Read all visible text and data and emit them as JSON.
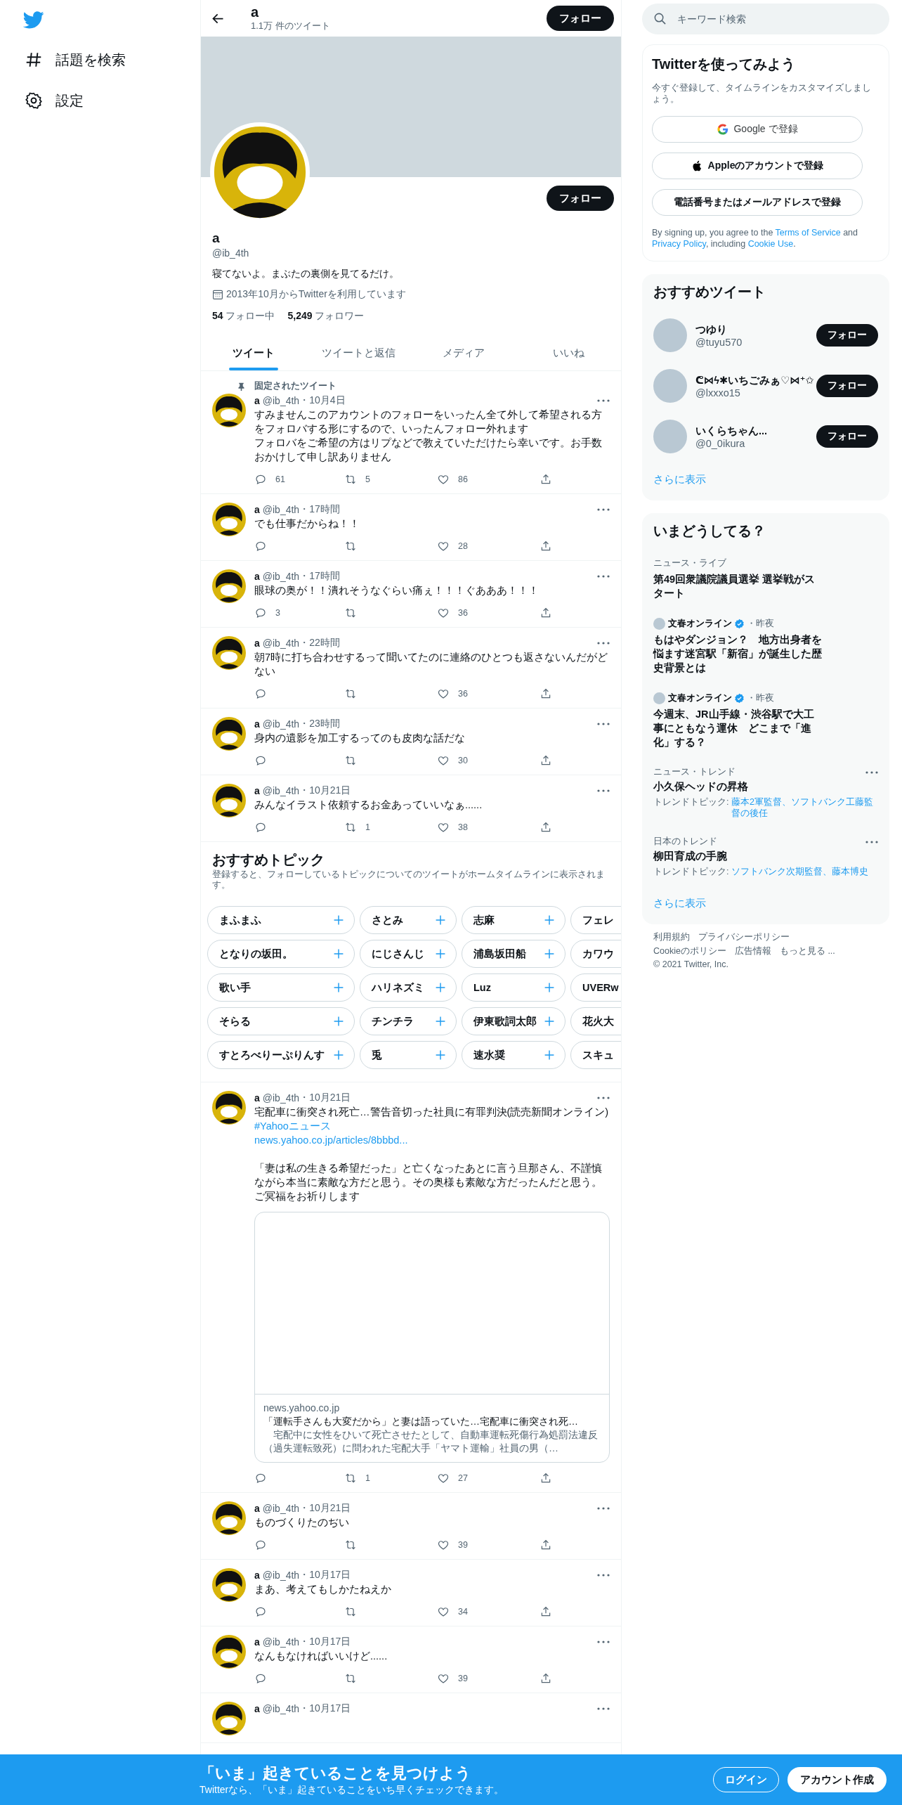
{
  "sidebar": {
    "items": [
      {
        "kind": "explore",
        "label": "話題を検索"
      },
      {
        "kind": "settings",
        "label": "設定"
      }
    ]
  },
  "header": {
    "title": "a",
    "subtitle": "1.1万 件のツイート",
    "follow": "フォロー"
  },
  "profile": {
    "follow": "フォロー",
    "name": "a",
    "handle": "@ib_4th",
    "bio": "寝てないよ。まぶたの裏側を見てるだけ。",
    "joined": "2013年10月からTwitterを利用しています",
    "following_count": "54",
    "following_label": "フォロー中",
    "followers_count": "5,249",
    "followers_label": "フォロワー"
  },
  "tabs": [
    {
      "label": "ツイート",
      "selected": true
    },
    {
      "label": "ツイートと返信",
      "selected": false
    },
    {
      "label": "メディア",
      "selected": false
    },
    {
      "label": "いいね",
      "selected": false
    }
  ],
  "timeline": [
    {
      "kind": "tweet",
      "pinned_label": "固定されたツイート",
      "name": "a",
      "handle": "@ib_4th",
      "time": "・10月4日",
      "text": "すみませんこのアカウントのフォローをいったん全て外して希望される方をフォロバする形にするので、いったんフォロー外れます",
      "text_more": "フォロバをご希望の方はリプなどで教えていただけたら幸いです。お手数おかけして申し訳ありません",
      "reply": "61",
      "retweet": "5",
      "like": "86"
    },
    {
      "kind": "tweet",
      "name": "a",
      "handle": "@ib_4th",
      "time": "・17時間",
      "text": "でも仕事だからね！！",
      "like": "28"
    },
    {
      "kind": "tweet",
      "name": "a",
      "handle": "@ib_4th",
      "time": "・17時間",
      "text": "眼球の奥が！！潰れそうなぐらい痛ぇ！！！ぐあああ！！！",
      "reply": "3",
      "like": "36"
    },
    {
      "kind": "tweet",
      "name": "a",
      "handle": "@ib_4th",
      "time": "・22時間",
      "text": "朝7時に打ち合わせするって聞いてたのに連絡のひとつも返さないんだがどない",
      "like": "36"
    },
    {
      "kind": "tweet",
      "name": "a",
      "handle": "@ib_4th",
      "time": "・23時間",
      "text": "身内の遺影を加工するってのも皮肉な話だな",
      "like": "30"
    },
    {
      "kind": "tweet",
      "name": "a",
      "handle": "@ib_4th",
      "time": "・10月21日",
      "text": "みんなイラスト依頼するお金あっていいなぁ......",
      "retweet": "1",
      "like": "38"
    },
    {
      "kind": "topics",
      "title": "おすすめトピック",
      "subtitle": "登録すると、フォローしているトピックについてのツイートがホームタイムラインに表示されます。",
      "topics": [
        {
          "label": "まふまふ",
          "kind": "full"
        },
        {
          "label": "さとみ",
          "kind": "full"
        },
        {
          "label": "志麻",
          "kind": "full"
        },
        {
          "label": "フェレ",
          "kind": "partial"
        },
        {
          "label": "となりの坂田。",
          "kind": "full"
        },
        {
          "label": "にじさんじ",
          "kind": "full"
        },
        {
          "label": "浦島坂田船",
          "kind": "full"
        },
        {
          "label": "カワウ",
          "kind": "partial"
        },
        {
          "label": "歌い手",
          "kind": "full"
        },
        {
          "label": "ハリネズミ",
          "kind": "full"
        },
        {
          "label": "Luz",
          "kind": "full"
        },
        {
          "label": "UVERw",
          "kind": "partial"
        },
        {
          "label": "そらる",
          "kind": "full"
        },
        {
          "label": "チンチラ",
          "kind": "full"
        },
        {
          "label": "伊東歌詞太郎",
          "kind": "full"
        },
        {
          "label": "花火大",
          "kind": "partial"
        },
        {
          "label": "すとろべりーぷりんす",
          "kind": "full"
        },
        {
          "label": "兎",
          "kind": "full"
        },
        {
          "label": "速水奨",
          "kind": "full"
        },
        {
          "label": "スキュ",
          "kind": "partial"
        }
      ]
    },
    {
      "kind": "tweet",
      "name": "a",
      "handle": "@ib_4th",
      "time": "・10月21日",
      "text": "宅配車に衝突され死亡…警告音切った社員に有罪判決(読売新聞オンライン)",
      "links": [
        "#Yahooニュース",
        "news.yahoo.co.jp/articles/8bbbd..."
      ],
      "text2": "「妻は私の生きる希望だった」と亡くなったあとに言う旦那さん、不謹慎ながら本当に素敵な方だと思う。その奥様も素敵な方だったんだと思う。ご冥福をお祈りします",
      "card": {
        "domain": "news.yahoo.co.jp",
        "title": "「運転手さんも大変だから」と妻は語っていた…宅配車に衝突され死…",
        "description": "　宅配中に女性をひいて死亡させたとして、自動車運転死傷行為処罰法違反（過失運転致死）に問われた宅配大手「ヤマト運輸」社員の男（…"
      },
      "retweet": "1",
      "like": "27"
    },
    {
      "kind": "tweet",
      "name": "a",
      "handle": "@ib_4th",
      "time": "・10月21日",
      "text": "ものづくりたのぢい",
      "like": "39"
    },
    {
      "kind": "tweet",
      "name": "a",
      "handle": "@ib_4th",
      "time": "・10月17日",
      "text": "まあ、考えてもしかたねえか",
      "like": "34"
    },
    {
      "kind": "tweet",
      "name": "a",
      "handle": "@ib_4th",
      "time": "・10月17日",
      "text": "なんもなければいいけど......",
      "like": "39"
    },
    {
      "kind": "tweet",
      "name": "a",
      "handle": "@ib_4th",
      "time": "・10月17日"
    }
  ],
  "search": {
    "placeholder": "キーワード検索"
  },
  "signup": {
    "title": "Twitterを使ってみよう",
    "subtitle": "今すぐ登録して、タイムラインをカスタマイズしましょう。",
    "buttons": [
      {
        "kind": "google",
        "label": "Google で登録"
      },
      {
        "kind": "apple",
        "label": "Appleのアカウントで登録"
      },
      {
        "kind": "plain",
        "label": "電話番号またはメールアドレスで登録"
      }
    ],
    "legal": [
      {
        "kind": "text",
        "text": "By signing up, you agree to the "
      },
      {
        "kind": "link",
        "text": "Terms of Service"
      },
      {
        "kind": "text",
        "text": " and "
      },
      {
        "kind": "link",
        "text": "Privacy Policy"
      },
      {
        "kind": "text",
        "text": ", including "
      },
      {
        "kind": "link",
        "text": "Cookie Use"
      },
      {
        "kind": "text",
        "text": "."
      }
    ]
  },
  "who_to_follow": {
    "title": "おすすめツイート",
    "users": [
      {
        "name": "つゆり",
        "handle": "@tuyu570",
        "follow": "フォロー"
      },
      {
        "name": "ᕦ⋈ϟ✱いちごみぁ♡⋈⁺✩",
        "handle": "@lxxxo15",
        "follow": "フォロー"
      },
      {
        "name": "いくらちゃん...",
        "handle": "@0_0ikura",
        "follow": "フォロー"
      }
    ],
    "more": "さらに表示"
  },
  "trends": {
    "title": "いまどうしてる？",
    "items": [
      {
        "kind": "plain",
        "meta": "ニュース・ライブ",
        "title": "第49回衆議院議員選挙 選挙戦がスタート"
      },
      {
        "kind": "source",
        "source": "文春オンライン",
        "verified": true,
        "time": "・昨夜",
        "title": "もはやダンジョン？　地方出身者を悩ます迷宮駅「新宿」が誕生した歴史背景とは"
      },
      {
        "kind": "source",
        "source": "文春オンライン",
        "verified": true,
        "time": "・昨夜",
        "title": "今週末、JR山手線・渋谷駅で大工事にともなう運休　どこまで「進化」する？"
      },
      {
        "kind": "trend",
        "meta": "ニュース・トレンド",
        "title": "小久保ヘッドの昇格",
        "topic_label": "トレンドトピック: ",
        "topics": "藤本2軍監督、ソフトバンク工藤監督の後任"
      },
      {
        "kind": "trend",
        "meta": "日本のトレンド",
        "title": "柳田育成の手腕",
        "topic_label": "トレンドトピック: ",
        "topics": "ソフトバンク次期監督、藤本博史"
      }
    ],
    "more": "さらに表示"
  },
  "footer": {
    "rows": [
      [
        "利用規約",
        "プライバシーポリシー"
      ],
      [
        "Cookieのポリシー",
        "広告情報",
        "もっと見る ..."
      ]
    ],
    "copyright": "© 2021 Twitter, Inc."
  },
  "banner": {
    "title": "「いま」起きていることを見つけよう",
    "subtitle": "Twitterなら、「いま」起きていることをいち早くチェックできます。",
    "login": "ログイン",
    "signup": "アカウント作成"
  }
}
